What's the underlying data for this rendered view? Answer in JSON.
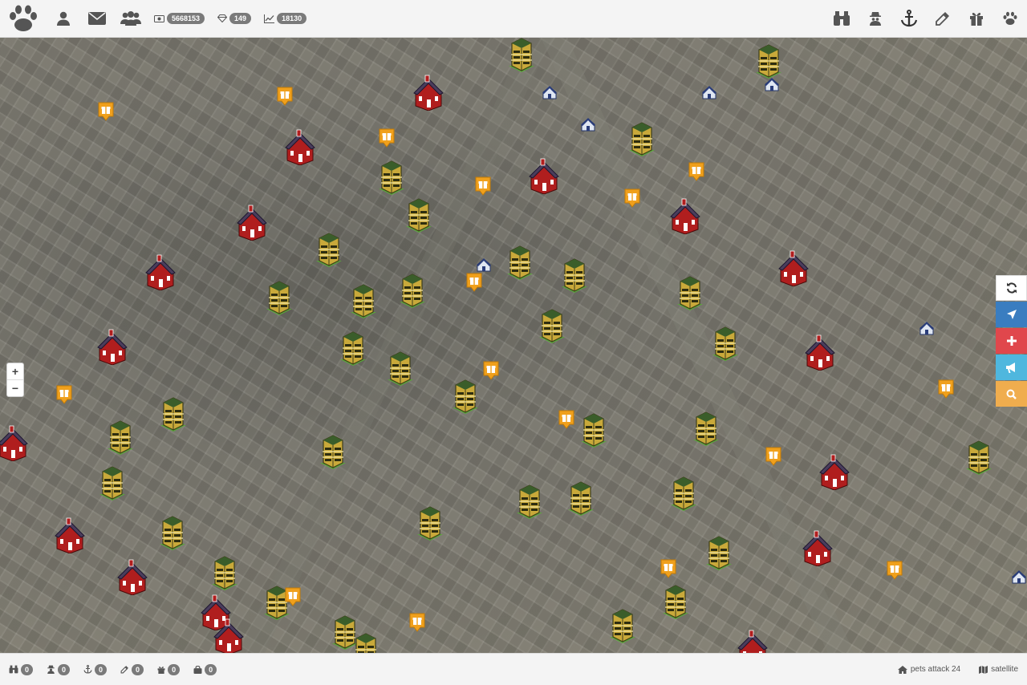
{
  "topbar": {
    "stats": [
      {
        "icon": "money-icon",
        "value": "5668153"
      },
      {
        "icon": "diamond-icon",
        "value": "149"
      },
      {
        "icon": "line-chart-icon",
        "value": "18130"
      }
    ]
  },
  "map": {
    "tiles": "satellite",
    "zoom_in": "+",
    "zoom_out": "−"
  },
  "bottombar": {
    "counters": [
      {
        "icon": "binoculars-icon",
        "value": "0"
      },
      {
        "icon": "spy-icon",
        "value": "0"
      },
      {
        "icon": "anchor-icon",
        "value": "0"
      },
      {
        "icon": "eyedropper-icon",
        "value": "0"
      },
      {
        "icon": "gift-icon",
        "value": "0"
      },
      {
        "icon": "bag-icon",
        "value": "0"
      }
    ],
    "pets_attack": "pets attack 24",
    "map_type": "satellite"
  },
  "colors": {
    "refresh": "#ffffff",
    "locate": "#3a7dc0",
    "add": "#e0474c",
    "announce": "#4fb7de",
    "search": "#f0ad4e"
  }
}
